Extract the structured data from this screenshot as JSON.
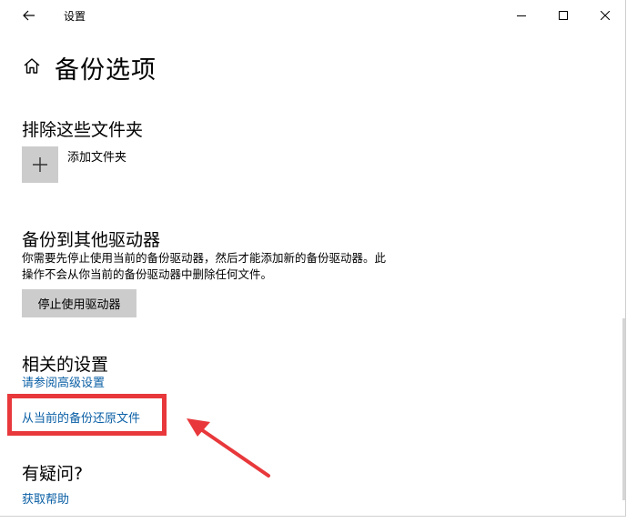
{
  "window": {
    "title": "设置"
  },
  "page": {
    "title": "备份选项"
  },
  "exclude": {
    "heading": "排除这些文件夹",
    "add_folder_label": "添加文件夹"
  },
  "other_drive": {
    "heading": "备份到其他驱动器",
    "description_line1": "你需要先停止使用当前的备份驱动器，然后才能添加新的备份驱动器。此",
    "description_line2": "操作不会从你当前的备份驱动器中删除任何文件。",
    "stop_button_label": "停止使用驱动器"
  },
  "related": {
    "heading": "相关的设置",
    "advanced_link": "请参阅高级设置",
    "restore_link": "从当前的备份还原文件"
  },
  "question": {
    "heading": "有疑问?",
    "help_link": "获取帮助"
  },
  "icons": {
    "back": "back-arrow-icon",
    "minimize": "minimize-icon",
    "maximize": "maximize-icon",
    "close": "close-icon",
    "home": "home-icon",
    "plus": "plus-icon"
  },
  "colors": {
    "link": "#0a5fa5",
    "highlight": "#e8383b",
    "tile": "#cccccc"
  }
}
